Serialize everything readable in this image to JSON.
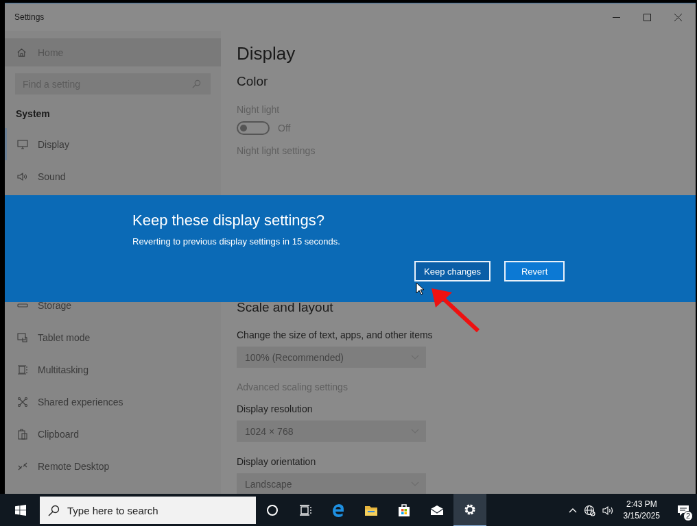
{
  "window": {
    "title": "Settings"
  },
  "sidebar": {
    "home": "Home",
    "search": {
      "placeholder": "Find a setting"
    },
    "section": "System",
    "items_above": [
      {
        "label": "Display",
        "selected": true
      },
      {
        "label": "Sound",
        "selected": false
      }
    ],
    "items_below": [
      {
        "label": "Storage",
        "selected": false
      },
      {
        "label": "Tablet mode",
        "selected": false
      },
      {
        "label": "Multitasking",
        "selected": false
      },
      {
        "label": "Shared experiences",
        "selected": false
      },
      {
        "label": "Clipboard",
        "selected": false
      },
      {
        "label": "Remote Desktop",
        "selected": false
      }
    ]
  },
  "content": {
    "title": "Display",
    "color_heading": "Color",
    "night_light": {
      "label": "Night light",
      "on": false,
      "state_text": "Off",
      "link": "Night light settings"
    },
    "scale_heading": "Scale and layout",
    "fields": [
      {
        "label": "Change the size of text, apps, and other items",
        "value": "100% (Recommended)"
      },
      {
        "kind": "link",
        "label": "Advanced scaling settings"
      },
      {
        "label": "Display resolution",
        "value": "1024 × 768"
      },
      {
        "label": "Display orientation",
        "value": "Landscape"
      }
    ]
  },
  "dialog": {
    "title": "Keep these display settings?",
    "message": "Reverting to previous display settings in 15 seconds.",
    "buttons": [
      {
        "label": "Keep changes",
        "focused": true
      },
      {
        "label": "Revert",
        "focused": false
      }
    ]
  },
  "taskbar": {
    "search": {
      "placeholder": "Type here to search"
    },
    "apps": [
      {
        "active": false
      },
      {
        "active": false
      },
      {
        "active": false
      },
      {
        "active": false
      },
      {
        "active": false
      },
      {
        "active": false
      },
      {
        "active": true
      }
    ],
    "time": "2:43 PM",
    "date": "3/15/2025",
    "notification_count": "2"
  }
}
